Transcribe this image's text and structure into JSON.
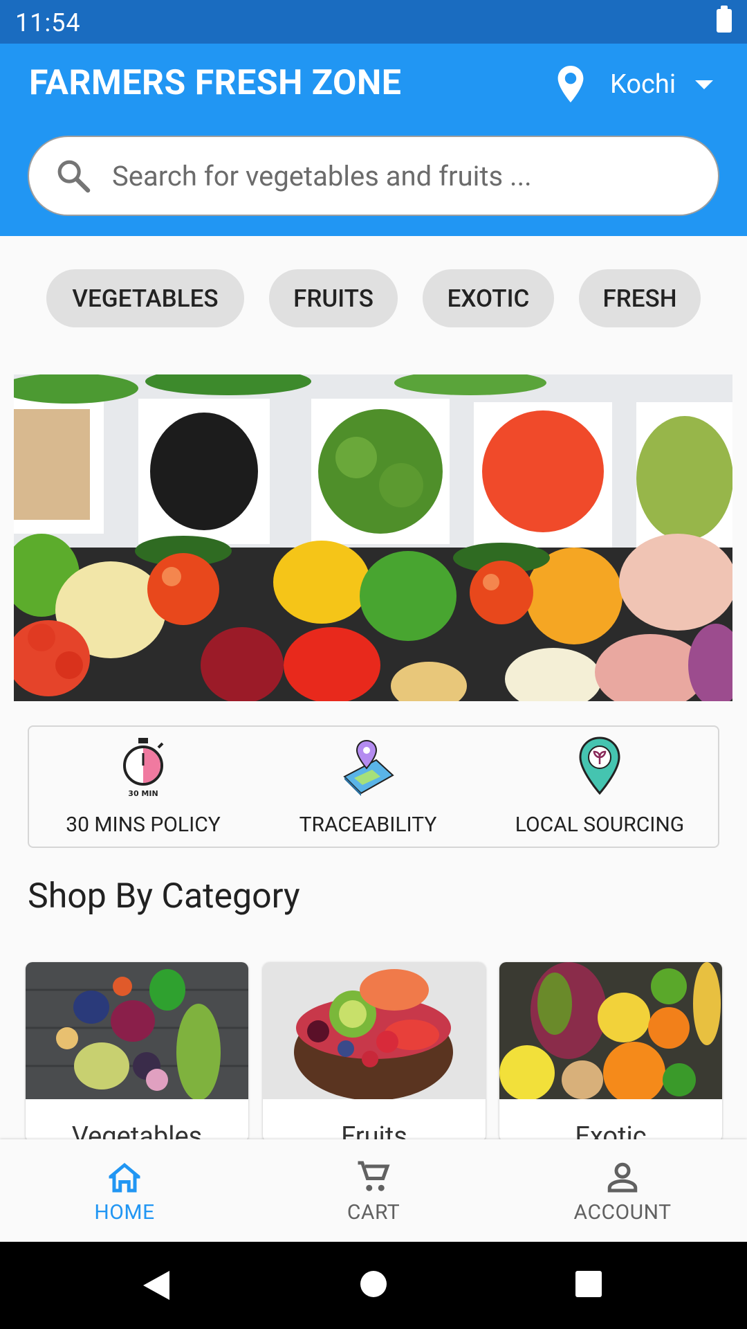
{
  "status_bar": {
    "time": "11:54"
  },
  "header": {
    "title": "FARMERS FRESH ZONE",
    "location": "Kochi",
    "search_placeholder": "Search for vegetables and fruits ..."
  },
  "chips": [
    "VEGETABLES",
    "FRUITS",
    "EXOTIC",
    "FRESH"
  ],
  "features": [
    {
      "label": "30 MINS POLICY",
      "icon": "stopwatch-icon",
      "icon_text": "30 MIN"
    },
    {
      "label": "TRACEABILITY",
      "icon": "map-pin-icon"
    },
    {
      "label": "LOCAL SOURCING",
      "icon": "local-pin-icon"
    }
  ],
  "section_title": "Shop By Category",
  "categories": [
    {
      "label": "Vegetables"
    },
    {
      "label": "Fruits"
    },
    {
      "label": "Exotic"
    }
  ],
  "bottom_nav": {
    "items": [
      {
        "label": "HOME",
        "icon": "home-icon",
        "active": true
      },
      {
        "label": "CART",
        "icon": "cart-icon",
        "active": false
      },
      {
        "label": "ACCOUNT",
        "icon": "account-icon",
        "active": false
      }
    ]
  },
  "colors": {
    "primary": "#2196f3",
    "status_bar": "#1a6cc0",
    "chip_bg": "#e0e0e0",
    "nav_active": "#2196f3",
    "nav_inactive": "#616161"
  }
}
